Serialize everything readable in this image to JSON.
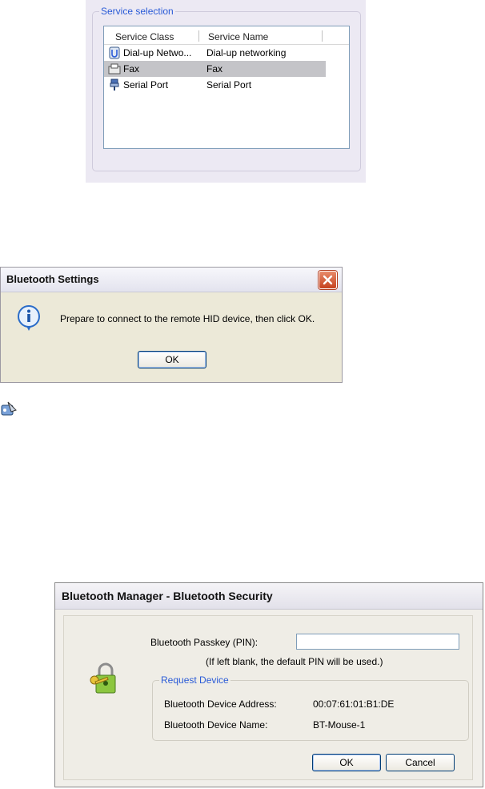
{
  "service_selection": {
    "legend": "Service selection",
    "columns": [
      "Service Class",
      "Service Name"
    ],
    "rows": [
      {
        "icon": "dialup-network-icon",
        "service_class": "Dial-up Netwo...",
        "service_name": "Dial-up networking",
        "selected": false
      },
      {
        "icon": "fax-icon",
        "service_class": "Fax",
        "service_name": "Fax",
        "selected": true
      },
      {
        "icon": "serial-port-icon",
        "service_class": "Serial Port",
        "service_name": "Serial Port",
        "selected": false
      }
    ]
  },
  "bt_settings": {
    "title": "Bluetooth Settings",
    "message": "Prepare to connect to the remote HID device, then click OK.",
    "ok_label": "OK",
    "icon": "info-icon",
    "close_icon": "close-icon"
  },
  "floating_icon": "bluetooth-tool-icon",
  "bt_security": {
    "title": "Bluetooth Manager - Bluetooth Security",
    "passkey_label": "Bluetooth Passkey (PIN):",
    "passkey_value": "",
    "hint": "(If left blank, the default PIN will be used.)",
    "group_legend": "Request Device",
    "address_label": "Bluetooth Device Address:",
    "address_value": "00:07:61:01:B1:DE",
    "name_label": "Bluetooth Device Name:",
    "name_value": "BT-Mouse-1",
    "ok_label": "OK",
    "cancel_label": "Cancel",
    "icon": "lock-key-icon"
  },
  "colors": {
    "accent_blue": "#2a5bd7",
    "selection": "#c4c4c8",
    "close_red": "#c6421f"
  }
}
